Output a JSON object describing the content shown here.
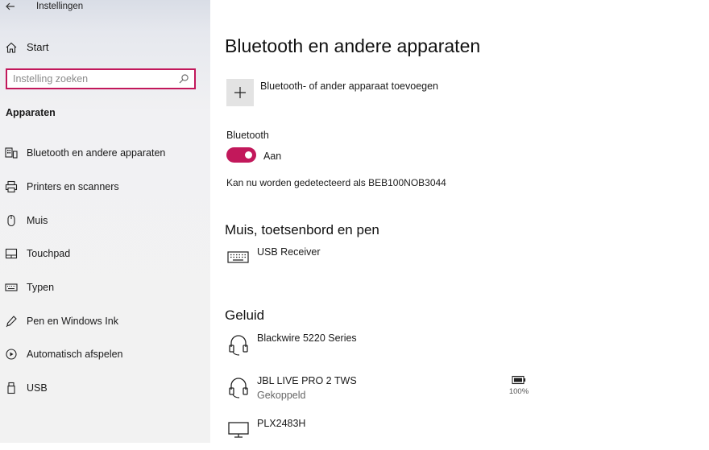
{
  "window": {
    "title": "Instellingen"
  },
  "sidebar": {
    "home_label": "Start",
    "search": {
      "placeholder": "Instelling zoeken",
      "value": ""
    },
    "section_heading": "Apparaten",
    "items": [
      {
        "label": "Bluetooth en andere apparaten",
        "icon": "bluetooth-devices-icon"
      },
      {
        "label": "Printers en scanners",
        "icon": "printer-icon"
      },
      {
        "label": "Muis",
        "icon": "mouse-icon"
      },
      {
        "label": "Touchpad",
        "icon": "touchpad-icon"
      },
      {
        "label": "Typen",
        "icon": "keyboard-icon"
      },
      {
        "label": "Pen en Windows Ink",
        "icon": "pen-icon"
      },
      {
        "label": "Automatisch afspelen",
        "icon": "autoplay-icon"
      },
      {
        "label": "USB",
        "icon": "usb-icon"
      }
    ]
  },
  "main": {
    "title": "Bluetooth en andere apparaten",
    "add_device_label": "Bluetooth- of ander apparaat toevoegen",
    "bluetooth": {
      "label": "Bluetooth",
      "state_label": "Aan",
      "on": true,
      "discoverable_text": "Kan nu worden gedetecteerd als BEB100NOB3044"
    },
    "groups": [
      {
        "title": "Muis, toetsenbord en pen",
        "devices": [
          {
            "name": "USB Receiver",
            "status": "",
            "icon": "keyboard-icon"
          }
        ]
      },
      {
        "title": "Geluid",
        "devices": [
          {
            "name": "Blackwire 5220 Series",
            "status": "",
            "icon": "headset-icon"
          },
          {
            "name": "JBL LIVE PRO 2 TWS",
            "status": "Gekoppeld",
            "icon": "headset-icon",
            "battery": "100%"
          },
          {
            "name": "PLX2483H",
            "status": "",
            "icon": "monitor-icon"
          }
        ]
      }
    ]
  },
  "colors": {
    "accent": "#c2185b",
    "sidebar_bg": "#f2f2f2",
    "tile_bg": "#e3e3e3"
  }
}
